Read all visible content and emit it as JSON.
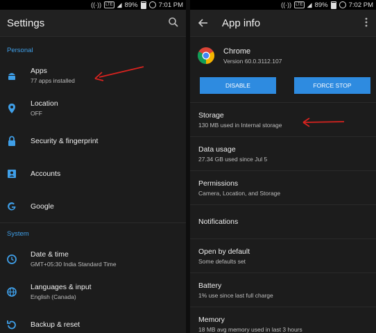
{
  "status_left": {
    "battery_percent": "89%",
    "time": "7:01 PM",
    "network": "LTE"
  },
  "status_right": {
    "battery_percent": "89%",
    "time": "7:02 PM",
    "network": "LTE"
  },
  "settings": {
    "title": "Settings",
    "section_personal": "Personal",
    "section_system": "System",
    "items": [
      {
        "title": "Apps",
        "subtitle": "77 apps installed",
        "icon": "android-icon"
      },
      {
        "title": "Location",
        "subtitle": "OFF",
        "icon": "location-pin-icon"
      },
      {
        "title": "Security & fingerprint",
        "subtitle": "",
        "icon": "lock-icon"
      },
      {
        "title": "Accounts",
        "subtitle": "",
        "icon": "account-box-icon"
      },
      {
        "title": "Google",
        "subtitle": "",
        "icon": "google-icon"
      }
    ],
    "system_items": [
      {
        "title": "Date & time",
        "subtitle": "GMT+05:30 India Standard Time",
        "icon": "clock-icon"
      },
      {
        "title": "Languages & input",
        "subtitle": "English (Canada)",
        "icon": "globe-icon"
      },
      {
        "title": "Backup & reset",
        "subtitle": "",
        "icon": "backup-icon"
      }
    ]
  },
  "app_info": {
    "title": "App info",
    "app_name": "Chrome",
    "version": "Version 60.0.3112.107",
    "disable_label": "DISABLE",
    "force_stop_label": "FORCE STOP",
    "items": [
      {
        "title": "Storage",
        "subtitle": "130 MB used in Internal storage"
      },
      {
        "title": "Data usage",
        "subtitle": "27.34 GB used since Jul 5"
      },
      {
        "title": "Permissions",
        "subtitle": "Camera, Location, and Storage"
      },
      {
        "title": "Notifications",
        "subtitle": ""
      },
      {
        "title": "Open by default",
        "subtitle": "Some defaults set"
      },
      {
        "title": "Battery",
        "subtitle": "1% use since last full charge"
      },
      {
        "title": "Memory",
        "subtitle": "18 MB avg memory used in last 3 hours"
      }
    ]
  },
  "colors": {
    "accent": "#3f9fe8",
    "button": "#2e8be0",
    "annotation_arrow": "#d9231f",
    "background": "#1c1c1c"
  }
}
